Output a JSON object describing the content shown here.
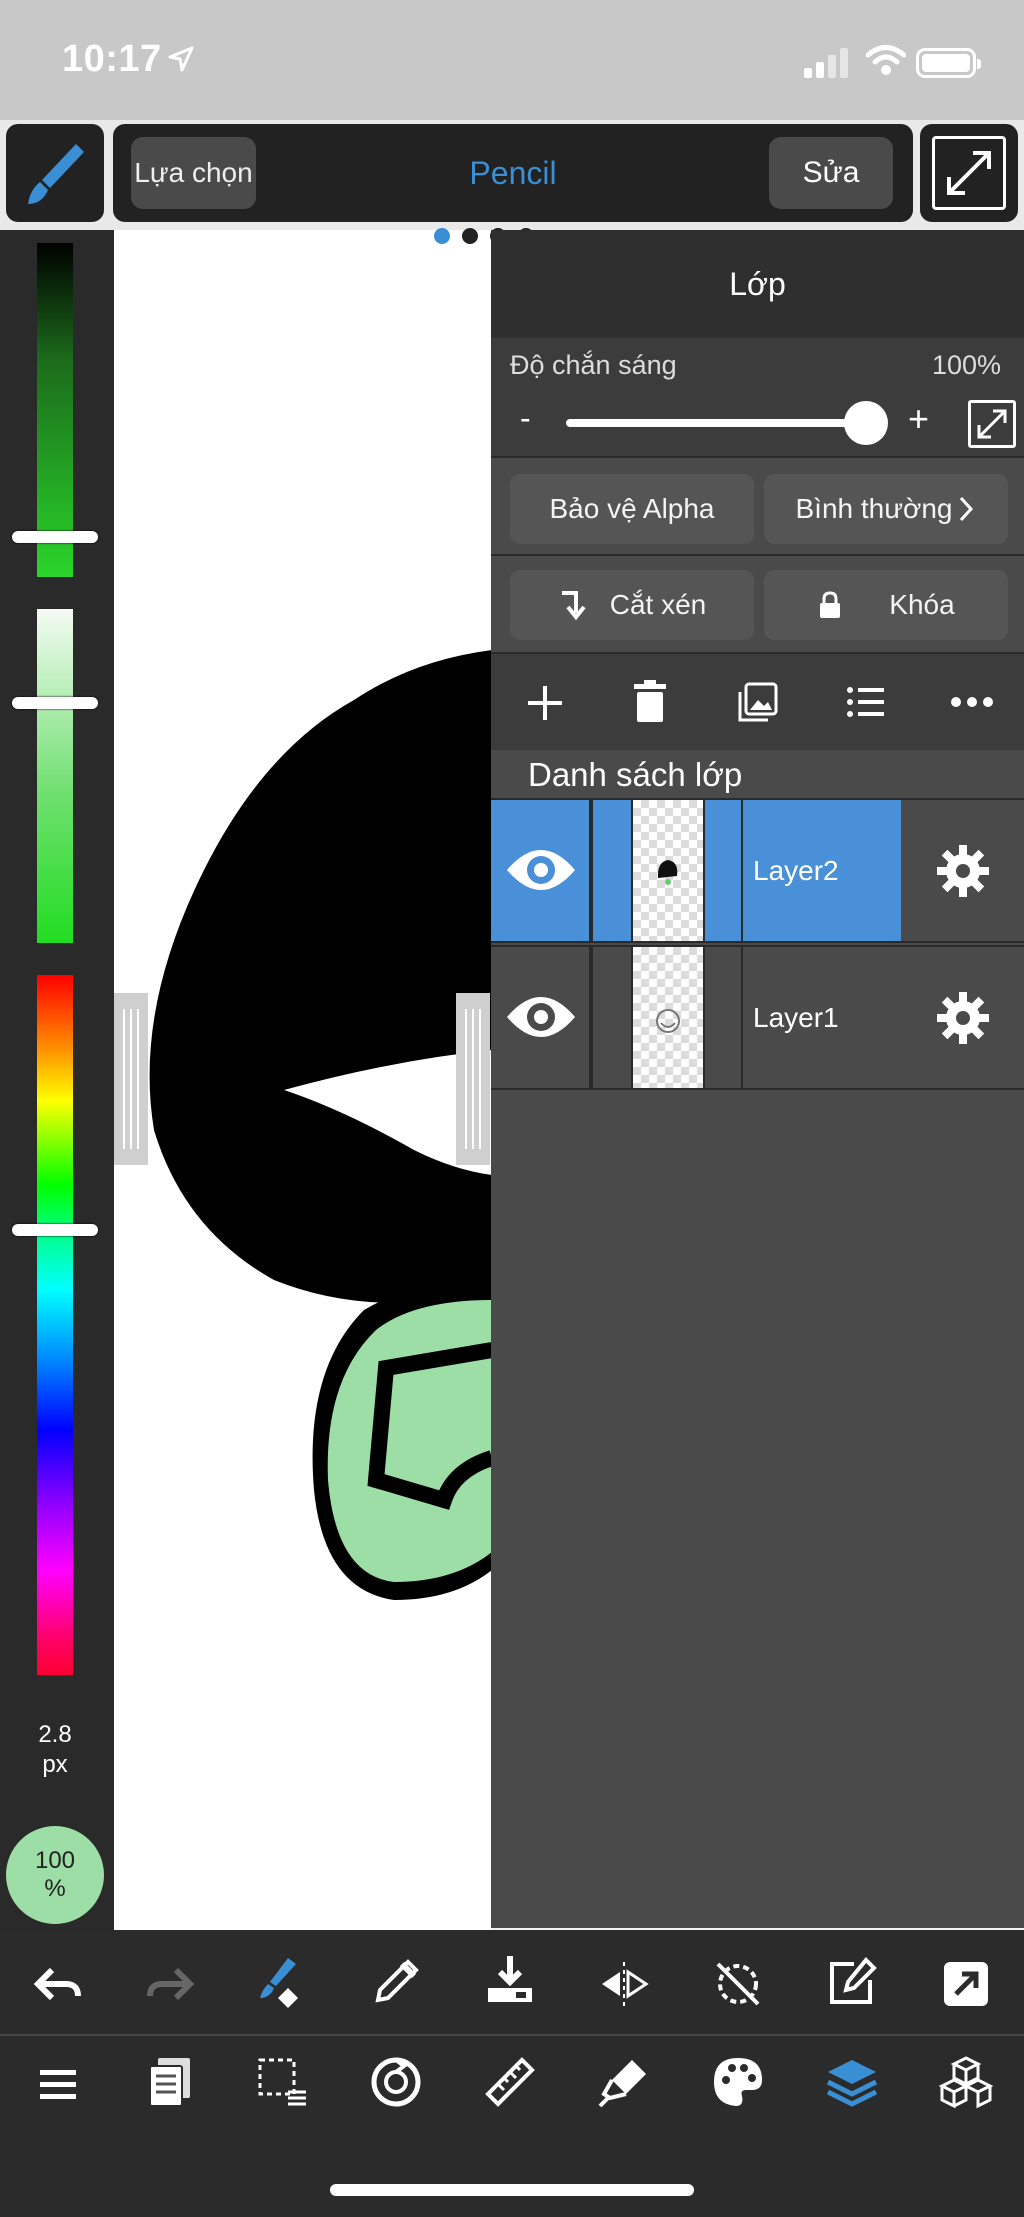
{
  "status_bar": {
    "time": "10:17"
  },
  "toolbar": {
    "select_label": "Lựa chọn",
    "tool_name": "Pencil",
    "edit_label": "Sửa"
  },
  "brush": {
    "size": "2.8",
    "size_unit": "px",
    "opacity": "100",
    "opacity_unit": "%"
  },
  "layer_panel": {
    "title": "Lớp",
    "opacity_label": "Độ chắn sáng",
    "opacity_value": "100%",
    "opacity_percent": 100,
    "minus": "-",
    "plus": "+",
    "protect_alpha": "Bảo vệ Alpha",
    "blend_mode": "Bình thường",
    "clipping": "Cắt xén",
    "lock": "Khóa",
    "list_title": "Danh sách lớp",
    "layers": [
      {
        "name": "Layer2",
        "selected": true,
        "visible": true
      },
      {
        "name": "Layer1",
        "selected": false,
        "visible": true
      }
    ]
  },
  "colors": {
    "accent": "#3a8fd4",
    "selected_layer": "#4a90d9",
    "panel": "#4a4a4a",
    "toolbar": "#222222",
    "opacity_circle": "#9ddea6"
  },
  "bottom_toolbar": {
    "row1": [
      "undo-icon",
      "redo-icon",
      "brush-transform-icon",
      "eyedropper-icon",
      "save-icon",
      "flip-icon",
      "rotate-reset-icon",
      "edit-icon",
      "share-icon"
    ],
    "row2": [
      "menu-icon",
      "pages-icon",
      "selection-icon",
      "transform-icon",
      "ruler-icon",
      "fill-icon",
      "palette-icon",
      "layers-icon",
      "materials-icon"
    ]
  }
}
